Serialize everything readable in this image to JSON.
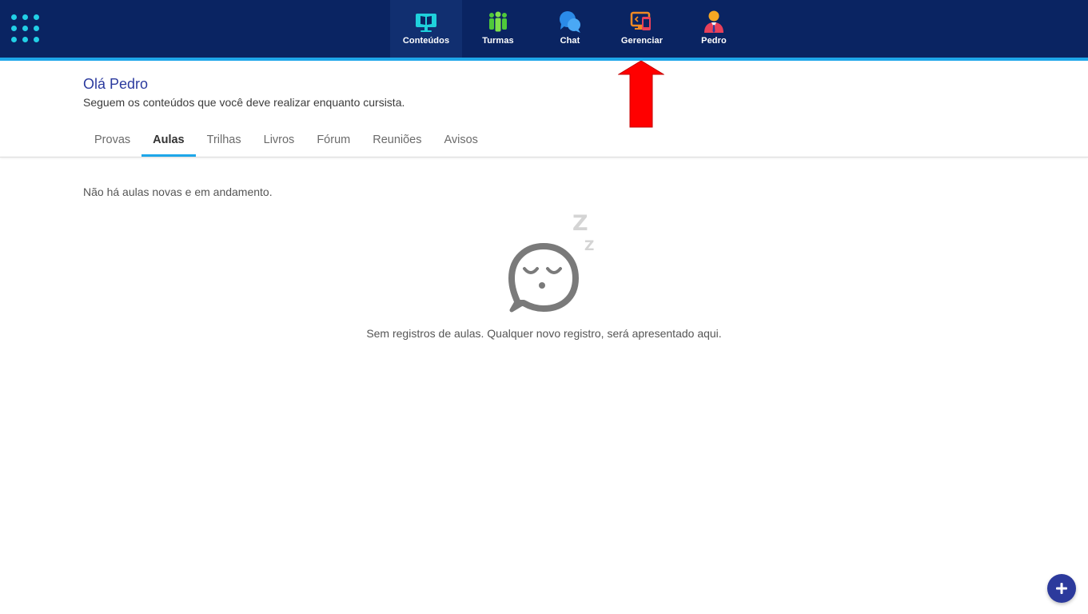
{
  "nav": {
    "items": [
      {
        "label": "Conteúdos",
        "icon": "monitor-book-icon",
        "active": true
      },
      {
        "label": "Turmas",
        "icon": "group-people-icon"
      },
      {
        "label": "Chat",
        "icon": "chat-bubbles-icon"
      },
      {
        "label": "Gerenciar",
        "icon": "manage-devices-icon"
      },
      {
        "label": "Pedro",
        "icon": "user-avatar-icon"
      }
    ]
  },
  "header": {
    "greeting_prefix": "Olá",
    "user_name": "Pedro",
    "subtitle": "Seguem os conteúdos que você deve realizar enquanto cursista."
  },
  "tabs": [
    "Provas",
    "Aulas",
    "Trilhas",
    "Livros",
    "Fórum",
    "Reuniões",
    "Avisos"
  ],
  "active_tab": "Aulas",
  "main": {
    "info_text": "Não há aulas novas e em andamento.",
    "empty_text": "Sem registros de aulas. Qualquer novo registro, será apresentado aqui.",
    "empty_icon": "sleeping-chat-icon",
    "sleep_letters": [
      "Z",
      "Z"
    ]
  },
  "colors": {
    "topbar": "#0a2462",
    "accent": "#1ea7ea",
    "greeting": "#2b3a9e",
    "fab": "#2c3a9c",
    "arrow": "#ff0000"
  }
}
